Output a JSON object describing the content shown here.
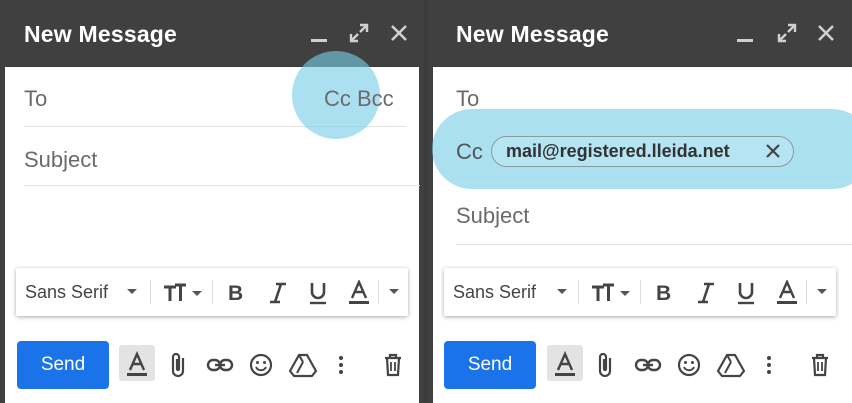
{
  "colors": {
    "accent": "#1a73e8",
    "highlight": "#78cde6",
    "titlebar": "#404040"
  },
  "left": {
    "title": "New Message",
    "to_label": "To",
    "cc_bcc_label": "Cc Bcc",
    "subject_placeholder": "Subject",
    "font_name": "Sans Serif",
    "send_label": "Send"
  },
  "right": {
    "title": "New Message",
    "to_label": "To",
    "cc_label": "Cc",
    "cc_chip": "mail@registered.lleida.net",
    "subject_placeholder": "Subject",
    "font_name": "Sans Serif",
    "send_label": "Send"
  },
  "icons": [
    "minimize-icon",
    "expand-icon",
    "close-icon",
    "font-size-icon",
    "bold-icon",
    "italic-icon",
    "underline-icon",
    "text-color-icon",
    "attach-icon",
    "link-icon",
    "emoji-icon",
    "drive-icon",
    "more-icon",
    "trash-icon"
  ]
}
